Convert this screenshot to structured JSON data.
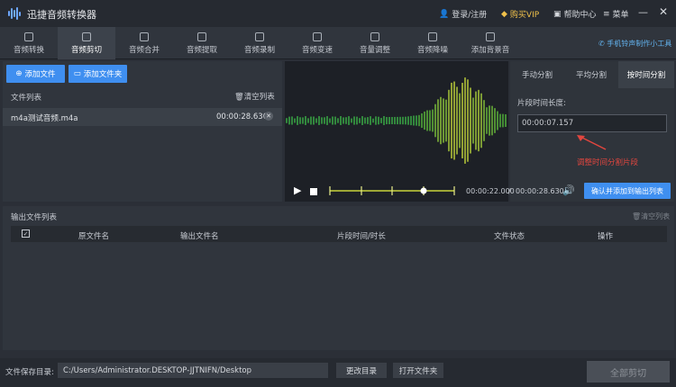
{
  "app": {
    "title": "迅捷音频转换器",
    "login": "登录/注册",
    "vip": "购买VIP",
    "help": "帮助中心",
    "menu": "菜单"
  },
  "nav": {
    "tabs": [
      {
        "label": "音频转换",
        "icon": "convert-icon"
      },
      {
        "label": "音频剪切",
        "icon": "scissors-icon"
      },
      {
        "label": "音频合并",
        "icon": "merge-icon"
      },
      {
        "label": "音频提取",
        "icon": "extract-icon"
      },
      {
        "label": "音频录制",
        "icon": "microphone-icon"
      },
      {
        "label": "音频变速",
        "icon": "speed-icon"
      },
      {
        "label": "音量调整",
        "icon": "volume-icon"
      },
      {
        "label": "音频降噪",
        "icon": "denoise-icon"
      },
      {
        "label": "添加背景音",
        "icon": "music-icon"
      }
    ],
    "active": 1,
    "promo": "手机铃声制作小工具"
  },
  "files": {
    "add_file": "添加文件",
    "add_folder": "添加文件夹",
    "list_title": "文件列表",
    "clear": "清空列表",
    "rows": [
      {
        "name": "m4a测试音频.m4a",
        "duration": "00:00:28.630"
      }
    ]
  },
  "split": {
    "tabs": [
      "手动分割",
      "平均分割",
      "按时间分割"
    ],
    "active": 2,
    "length_label": "片段时间长度:",
    "length_value": "00:00:07.157",
    "annotation": "调整时间分割片段"
  },
  "player": {
    "current": "00:00:22.000",
    "separator": "/",
    "total": "00:00:28.630",
    "confirm": "确认并添加到输出列表"
  },
  "output": {
    "title": "输出文件列表",
    "clear": "清空列表",
    "columns": [
      "原文件名",
      "输出文件名",
      "片段时间/时长",
      "文件状态",
      "操作"
    ]
  },
  "bottom": {
    "save_label": "文件保存目录:",
    "path": "C:/Users/Administrator.DESKTOP-JJTNIFN/Desktop",
    "change_dir": "更改目录",
    "open_folder": "打开文件夹",
    "cut_all": "全部剪切"
  }
}
